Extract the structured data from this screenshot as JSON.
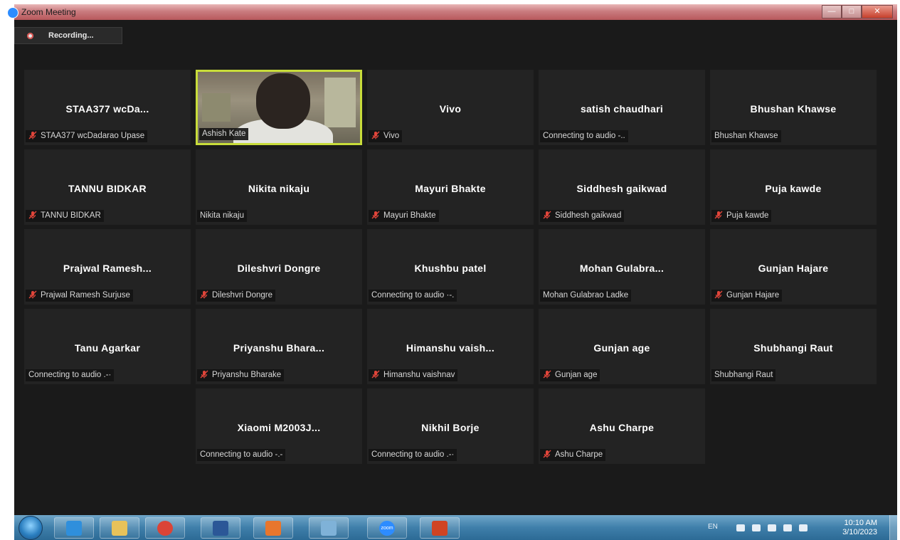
{
  "window": {
    "title": "Zoom Meeting"
  },
  "recording": {
    "label": "Recording..."
  },
  "participants": [
    {
      "name": "STAA377  wcDa...",
      "label": "STAA377 wcDadarao Upase",
      "muted": true
    },
    {
      "name": "",
      "label": "Ashish Kate",
      "muted": false,
      "video": true
    },
    {
      "name": "Vivo",
      "label": "Vivo",
      "muted": true
    },
    {
      "name": "satish chaudhari",
      "label": "Connecting to audio -..",
      "muted": false
    },
    {
      "name": "Bhushan Khawse",
      "label": "Bhushan Khawse",
      "muted": false
    },
    {
      "name": "TANNU BIDKAR",
      "label": "TANNU BIDKAR",
      "muted": true
    },
    {
      "name": "Nikita nikaju",
      "label": "Nikita nikaju",
      "muted": false
    },
    {
      "name": "Mayuri Bhakte",
      "label": "Mayuri Bhakte",
      "muted": true
    },
    {
      "name": "Siddhesh gaikwad",
      "label": "Siddhesh gaikwad",
      "muted": true
    },
    {
      "name": "Puja kawde",
      "label": "Puja kawde",
      "muted": true
    },
    {
      "name": "Prajwal  Ramesh...",
      "label": "Prajwal Ramesh Surjuse",
      "muted": true
    },
    {
      "name": "Dileshvri Dongre",
      "label": "Dileshvri Dongre",
      "muted": true
    },
    {
      "name": "Khushbu patel",
      "label": "Connecting to audio ·-.",
      "muted": false
    },
    {
      "name": "Mohan  Gulabra...",
      "label": "Mohan Gulabrao Ladke",
      "muted": false
    },
    {
      "name": "Gunjan Hajare",
      "label": "Gunjan Hajare",
      "muted": true
    },
    {
      "name": "Tanu Agarkar",
      "label": "Connecting to audio .-·",
      "muted": false
    },
    {
      "name": "Priyanshu  Bhara...",
      "label": "Priyanshu Bharake",
      "muted": true
    },
    {
      "name": "Himanshu  vaish...",
      "label": "Himanshu vaishnav",
      "muted": true
    },
    {
      "name": "Gunjan age",
      "label": "Gunjan age",
      "muted": true
    },
    {
      "name": "Shubhangi Raut",
      "label": "Shubhangi Raut",
      "muted": false
    },
    {
      "name": "Xiaomi  M2003J...",
      "label": "Connecting to audio -.-",
      "muted": false
    },
    {
      "name": "Nikhil Borje",
      "label": "Connecting to audio .-·",
      "muted": false
    },
    {
      "name": "Ashu Charpe",
      "label": "Ashu Charpe",
      "muted": true
    }
  ],
  "taskbar": {
    "apps": [
      {
        "name": "internet-explorer-icon",
        "color": "#2f8fdc"
      },
      {
        "name": "file-explorer-icon",
        "color": "#e8c25a"
      },
      {
        "name": "chrome-icon",
        "color": "#db4437"
      },
      {
        "name": "word-icon",
        "color": "#2b5797"
      },
      {
        "name": "media-player-icon",
        "color": "#e8762d"
      },
      {
        "name": "paint-icon",
        "color": "#7fb2d8"
      },
      {
        "name": "zoom-icon",
        "color": "#2d8cff",
        "text": "zoom"
      },
      {
        "name": "powerpoint-icon",
        "color": "#d04423"
      }
    ],
    "language": "EN",
    "time": "10:10 AM",
    "date": "3/10/2023"
  },
  "colors": {
    "active_speaker_border": "#c8dc3a",
    "muted_icon": "#e0453a",
    "tile_bg": "#232323"
  }
}
